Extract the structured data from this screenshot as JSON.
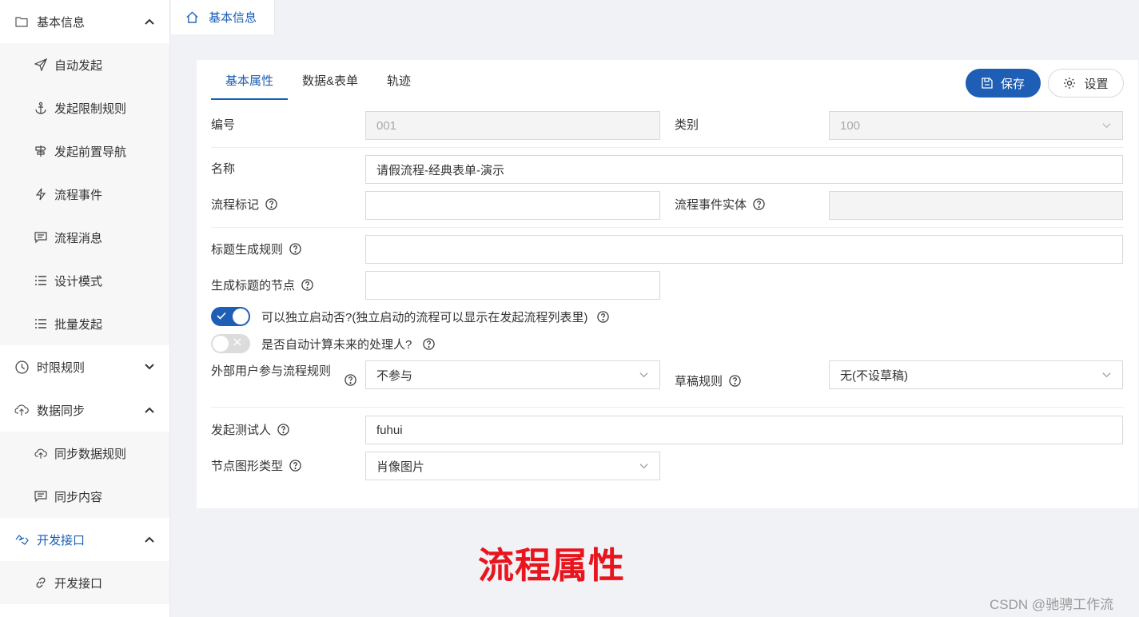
{
  "sidebar": {
    "groups": [
      {
        "label": "基本信息",
        "icon": "folder-icon",
        "expanded": true,
        "items": [
          {
            "label": "自动发起",
            "icon": "send-icon"
          },
          {
            "label": "发起限制规则",
            "icon": "anchor-icon"
          },
          {
            "label": "发起前置导航",
            "icon": "signpost-icon"
          },
          {
            "label": "流程事件",
            "icon": "lightning-icon"
          },
          {
            "label": "流程消息",
            "icon": "message-icon"
          },
          {
            "label": "设计模式",
            "icon": "list-icon"
          },
          {
            "label": "批量发起",
            "icon": "list-icon"
          }
        ]
      },
      {
        "label": "时限规则",
        "icon": "clock-icon",
        "expanded": false
      },
      {
        "label": "数据同步",
        "icon": "cloud-upload-icon",
        "expanded": true,
        "items": [
          {
            "label": "同步数据规则",
            "icon": "cloud-upload-icon"
          },
          {
            "label": "同步内容",
            "icon": "message-icon"
          }
        ]
      },
      {
        "label": "开发接口",
        "icon": "api-icon",
        "expanded": true,
        "active": true,
        "items": [
          {
            "label": "开发接口",
            "icon": "link-icon"
          }
        ]
      }
    ]
  },
  "breadcrumb": {
    "label": "基本信息",
    "icon": "home-icon"
  },
  "tabs": [
    {
      "label": "基本属性",
      "active": true
    },
    {
      "label": "数据&表单",
      "active": false
    },
    {
      "label": "轨迹",
      "active": false
    }
  ],
  "toolbar": {
    "save_label": "保存",
    "settings_label": "设置"
  },
  "form": {
    "code": {
      "label": "编号",
      "value": "001"
    },
    "category": {
      "label": "类别",
      "value": "100"
    },
    "name": {
      "label": "名称",
      "value": "请假流程-经典表单-演示"
    },
    "flow_mark": {
      "label": "流程标记",
      "value": ""
    },
    "event_entity": {
      "label": "流程事件实体",
      "value": ""
    },
    "title_rule": {
      "label": "标题生成规则",
      "value": ""
    },
    "title_node": {
      "label": "生成标题的节点",
      "value": ""
    },
    "standalone": {
      "label": "可以独立启动否?(独立启动的流程可以显示在发起流程列表里)",
      "on": true
    },
    "auto_calc": {
      "label": "是否自动计算未来的处理人?",
      "on": false
    },
    "external_user": {
      "label": "外部用户参与流程规则",
      "value": "不参与"
    },
    "draft_rule": {
      "label": "草稿规则",
      "value": "无(不设草稿)"
    },
    "tester": {
      "label": "发起测试人",
      "value": "fuhui"
    },
    "node_shape": {
      "label": "节点图形类型",
      "value": "肖像图片"
    }
  },
  "overlay_title": "流程属性",
  "watermark": "CSDN @驰骋工作流",
  "colors": {
    "accent": "#1e5fb5",
    "title_red": "#e8151e"
  }
}
